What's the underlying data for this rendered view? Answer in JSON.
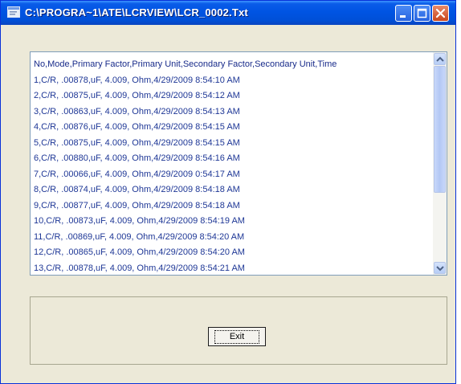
{
  "window": {
    "title": "C:\\PROGRA~1\\ATE\\LCRVIEW\\LCR_0002.Txt"
  },
  "list": {
    "lines": [
      "No,Mode,Primary  Factor,Primary Unit,Secondary Factor,Secondary Unit,Time",
      "1,C/R, .00878,uF, 4.009, Ohm,4/29/2009 8:54:10 AM",
      "2,C/R, .00875,uF, 4.009, Ohm,4/29/2009 8:54:12 AM",
      "3,C/R, .00863,uF, 4.009, Ohm,4/29/2009 8:54:13 AM",
      "4,C/R, .00876,uF, 4.009, Ohm,4/29/2009 8:54:15 AM",
      "5,C/R, .00875,uF, 4.009, Ohm,4/29/2009 8:54:15 AM",
      "6,C/R, .00880,uF, 4.009, Ohm,4/29/2009 8:54:16 AM",
      "7,C/R, .00066,uF, 4.009, Ohm,4/29/2009 0:54:17 AM",
      "8,C/R, .00874,uF, 4.009, Ohm,4/29/2009 8:54:18 AM",
      "9,C/R, .00877,uF, 4.009, Ohm,4/29/2009 8:54:18 AM",
      "10,C/R, .00873,uF, 4.009, Ohm,4/29/2009 8:54:19 AM",
      "11,C/R, .00869,uF, 4.009, Ohm,4/29/2009 8:54:20 AM",
      "12,C/R, .00865,uF, 4.009, Ohm,4/29/2009 8:54:20 AM",
      "13,C/R, .00878,uF, 4.009, Ohm,4/29/2009 8:54:21 AM"
    ]
  },
  "buttons": {
    "exit_label": "Exit"
  },
  "icons": {
    "app": "app-window-icon",
    "minimize": "minimize-icon",
    "maximize": "maximize-icon",
    "close": "close-icon",
    "scroll_up": "chevron-up-icon",
    "scroll_down": "chevron-down-icon"
  },
  "colors": {
    "title_bar": "#0054e3",
    "list_text": "#1e3796",
    "window_bg": "#ece9d8",
    "close_button": "#c9461d"
  }
}
